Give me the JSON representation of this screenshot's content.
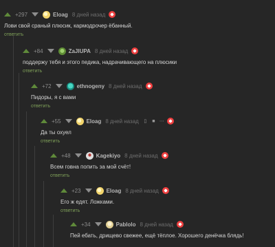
{
  "comments": [
    {
      "rating": "+297",
      "author": "Eloag",
      "time": "8 дней назад",
      "text": "Лови свой сраный плюсик, кармодрочер ёбанный.",
      "reply": "ответить",
      "avatar": "sun-avatar"
    },
    {
      "rating": "+84",
      "author": "ZaJIUPA",
      "time": "8 дней назад",
      "text": "поддержу тебя и этого педика, надрачивающего на плюсики",
      "reply": "ответить",
      "avatar": "frog-avatar"
    },
    {
      "rating": "+72",
      "author": "ethnogeny",
      "time": "8 дней назад",
      "text": "Пидоры, я с вами",
      "reply": "ответить",
      "avatar": "teal-avatar"
    },
    {
      "rating": "+55",
      "author": "Eloag",
      "time": "8 дней назад",
      "text": "Да ты охуел",
      "reply": "ответить",
      "avatar": "sun-avatar"
    },
    {
      "rating": "+48",
      "author": "Kagekiyo",
      "time": "8 дней назад",
      "text": "Всем говна попить за мой счёт!",
      "reply": "ответить",
      "avatar": "red-white-avatar"
    },
    {
      "rating": "+23",
      "author": "Eloag",
      "time": "8 дней назад",
      "text": "Его ж едят. Ложками.",
      "reply": "ответить",
      "avatar": "sun-avatar"
    },
    {
      "rating": "+34",
      "author": "Pablolo",
      "time": "8 дней назад",
      "text": "Пей ебать, дрищево свежее, ещё тёплое. Хорошего денёчка блядь!",
      "reply": "ответить",
      "avatar": "cream-avatar"
    }
  ],
  "icons": {
    "vote_up": "vote-up-icon",
    "vote_down": "vote-down-icon",
    "brand": "pikabu-icon",
    "bookmark": "bookmark-icon",
    "save": "save-icon",
    "more": "more-icon"
  },
  "colors": {
    "background": "#262626",
    "text": "#d7d7d7",
    "author": "#b6b6b6",
    "muted": "#6f6f6f",
    "link": "#7e9f58",
    "brand": "#ef3f3f"
  }
}
